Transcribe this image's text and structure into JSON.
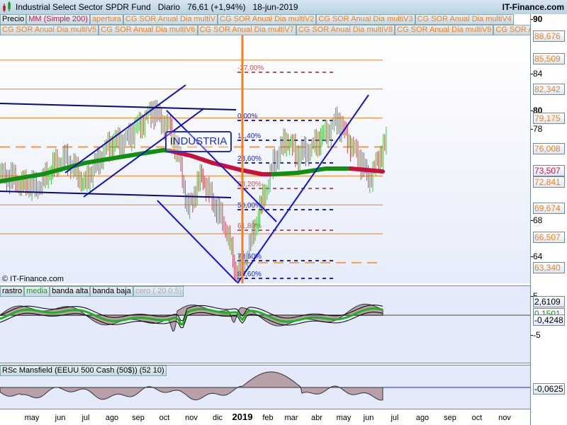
{
  "header": {
    "instrument": "Industrial Select Sector SPDR Fund",
    "period": "Diario",
    "price": "76,61 (+1,94%)",
    "date": "18-jun-2019",
    "site": "IT-Finance.com"
  },
  "legend_row1": [
    "Precio",
    "MM (Simple 200)",
    "apertura",
    "CG SOR Anual Dia multiV",
    "CG SOR Anual Dia multiV2",
    "CG SOR Anual Dia multiV3",
    "CG SOR Anual Dia multiV4"
  ],
  "legend_row2": [
    "CG SOR Anual Dia multiV5",
    "CG SOR Anual Dia multiV6",
    "CG SOR Anual Dia multiV7",
    "CG SOR Anual Dia multiV8",
    "CG SOR Anual Dia multiV9",
    "CG SOR Anual Dia"
  ],
  "annotation": "INDUSTRIA",
  "copyright": "© IT-Finance.com",
  "fib_labels": [
    "-27,00%",
    "0,00%",
    "11,40%",
    "23,60%",
    "38,20%",
    "50,00%",
    "61,80%",
    "78,60%",
    "88,60%"
  ],
  "price_axis": {
    "ticks": [
      "90",
      "84",
      "80",
      "78",
      "68",
      "64"
    ],
    "boxes": [
      {
        "v": "88,676",
        "c": "#f08020"
      },
      {
        "v": "85,509",
        "c": "#f08020"
      },
      {
        "v": "82,342",
        "c": "#f08020"
      },
      {
        "v": "79,175",
        "c": "#f08020"
      },
      {
        "v": "76,008",
        "c": "#f08020"
      },
      {
        "v": "73,507",
        "c": "#d0104a"
      },
      {
        "v": "72,841",
        "c": "#f08020"
      },
      {
        "v": "69,674",
        "c": "#f08020"
      },
      {
        "v": "66,507",
        "c": "#f08020"
      },
      {
        "v": "63,340",
        "c": "#f08020"
      }
    ]
  },
  "indicator1": {
    "legend": [
      "rastro",
      "media",
      "banda alta",
      "banda baja",
      "cero ( 20 0.5)"
    ],
    "ticks": [
      "5",
      "-5"
    ],
    "values": [
      "2,6109",
      "0,1501",
      "-0,4248"
    ]
  },
  "indicator2": {
    "legend": "RSc Mansfield (EEUU 500 Cash (50$)) (52 10)",
    "value": "-0,0625"
  },
  "x_axis": [
    "may",
    "jun",
    "jul",
    "ago",
    "sep",
    "oct",
    "nov",
    "dic",
    "2019",
    "feb",
    "mar",
    "abr",
    "may",
    "jun",
    "jul",
    "ago",
    "sep",
    "oct",
    "nov"
  ],
  "price_path": [
    [
      0,
      73
    ],
    [
      50,
      71.5
    ],
    [
      90,
      75
    ],
    [
      120,
      72
    ],
    [
      150,
      76
    ],
    [
      180,
      77
    ],
    [
      215,
      80
    ],
    [
      240,
      78
    ],
    [
      255,
      74
    ],
    [
      265,
      69
    ],
    [
      285,
      73
    ],
    [
      300,
      70
    ],
    [
      320,
      67
    ],
    [
      332,
      62.3
    ],
    [
      342,
      63
    ],
    [
      355,
      66
    ],
    [
      370,
      70
    ],
    [
      385,
      74
    ],
    [
      405,
      77
    ],
    [
      420,
      75
    ],
    [
      440,
      76
    ],
    [
      460,
      77.5
    ],
    [
      475,
      79
    ],
    [
      490,
      77
    ],
    [
      505,
      75
    ],
    [
      520,
      72.5
    ],
    [
      530,
      74
    ],
    [
      545,
      76.6
    ]
  ]
}
